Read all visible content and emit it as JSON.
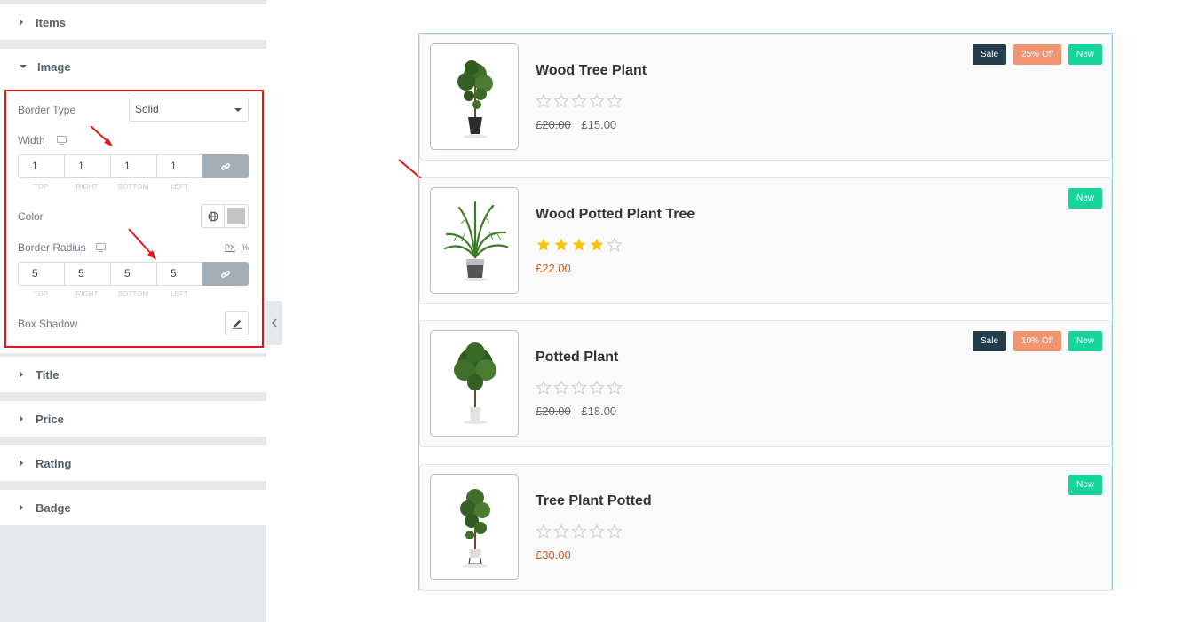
{
  "panel": {
    "sections": {
      "items": "Items",
      "image": "Image",
      "title": "Title",
      "price": "Price",
      "rating": "Rating",
      "badge": "Badge"
    },
    "image": {
      "border_type_label": "Border Type",
      "border_type_value": "Solid",
      "width_label": "Width",
      "width_values": [
        "1",
        "1",
        "1",
        "1"
      ],
      "dim_labels": [
        "TOP",
        "RIGHT",
        "BOTTOM",
        "LEFT"
      ],
      "color_label": "Color",
      "color_value": "#c4c4c4",
      "radius_label": "Border Radius",
      "radius_values": [
        "5",
        "5",
        "5",
        "5"
      ],
      "unit_px": "PX",
      "unit_pct": "%",
      "box_shadow_label": "Box Shadow"
    }
  },
  "products": [
    {
      "title": "Wood Tree Plant",
      "rating": 0,
      "old_price": "£20.00",
      "price": "£15.00",
      "badges": [
        "Sale",
        "25% Off",
        "New"
      ]
    },
    {
      "title": "Wood Potted Plant Tree",
      "rating": 4,
      "old_price": "",
      "price": "£22.00",
      "badges": [
        "New"
      ]
    },
    {
      "title": "Potted Plant",
      "rating": 0,
      "old_price": "£20.00",
      "price": "£18.00",
      "badges": [
        "Sale",
        "10% Off",
        "New"
      ]
    },
    {
      "title": "Tree Plant Potted",
      "rating": 0,
      "old_price": "",
      "price": "£30.00",
      "badges": [
        "New"
      ]
    }
  ],
  "colors": {
    "star_filled": "#f6c40c",
    "star_empty": "#d2d2d2",
    "sale": "#233c4c",
    "off": "#f0956f",
    "new": "#17d39c",
    "highlight": "#e4141b"
  }
}
